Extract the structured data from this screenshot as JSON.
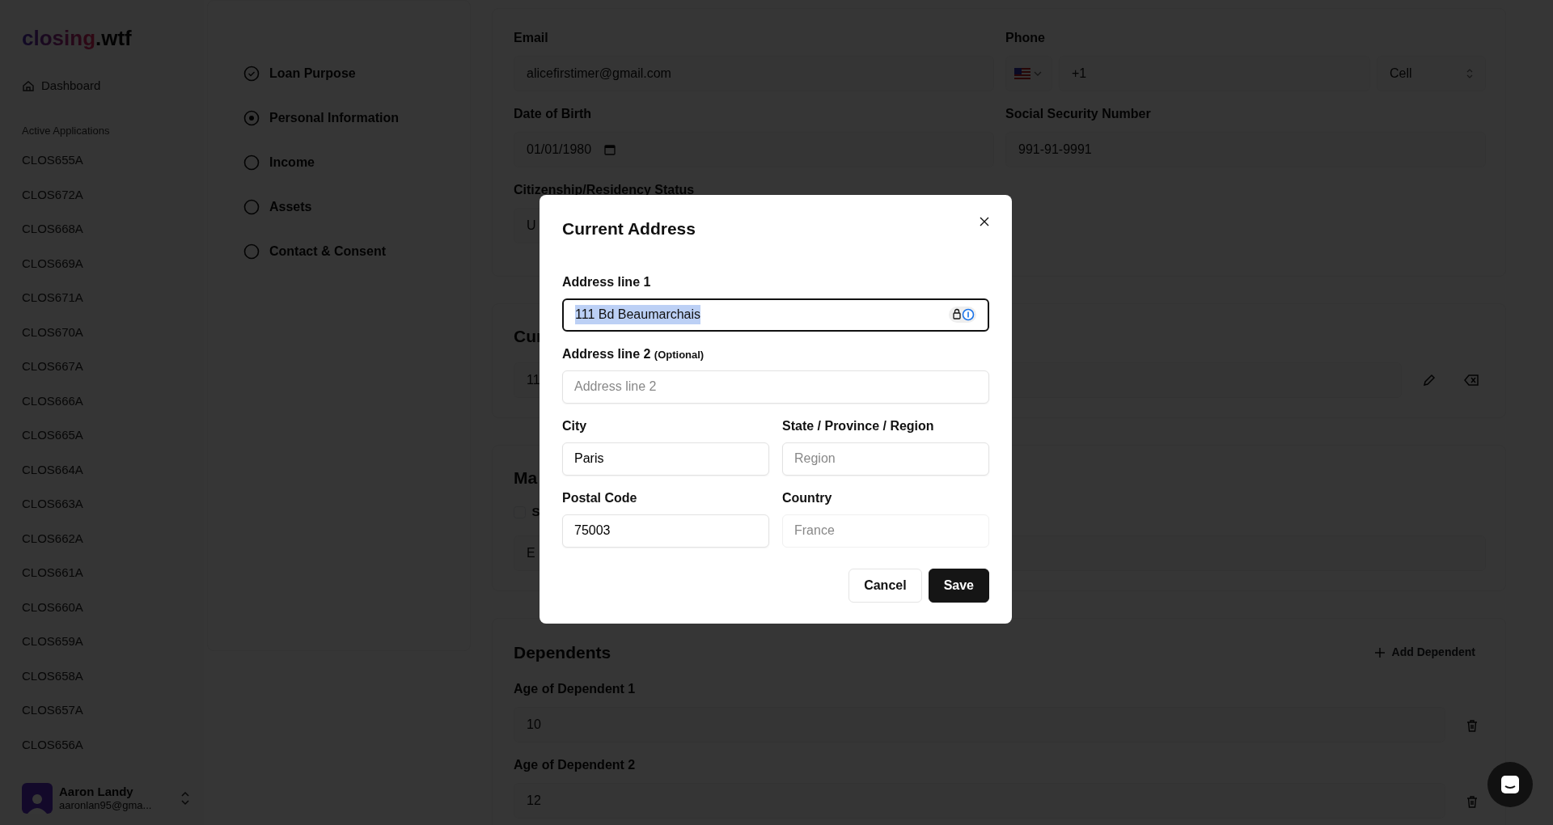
{
  "sidebar": {
    "logo": {
      "name": "closing",
      "suffix": ".wtf"
    },
    "nav": [
      {
        "label": "Dashboard"
      }
    ],
    "section_title": "Active Applications",
    "applications": [
      "CLOS655A",
      "CLOS672A",
      "CLOS668A",
      "CLOS669A",
      "CLOS671A",
      "CLOS670A",
      "CLOS667A",
      "CLOS666A",
      "CLOS665A",
      "CLOS664A",
      "CLOS663A",
      "CLOS662A",
      "CLOS661A",
      "CLOS660A",
      "CLOS659A",
      "CLOS658A",
      "CLOS657A",
      "CLOS656A"
    ],
    "user": {
      "name": "Aaron Landy",
      "email": "aaronlan95@gma..."
    }
  },
  "steps": [
    {
      "label": "Loan Purpose",
      "done": true,
      "current": false
    },
    {
      "label": "Personal Information",
      "done": false,
      "current": true
    },
    {
      "label": "Income",
      "done": false,
      "current": false
    },
    {
      "label": "Assets",
      "done": false,
      "current": false
    },
    {
      "label": "Contact & Consent",
      "done": false,
      "current": false
    }
  ],
  "personal_info": {
    "fields": [
      {
        "label": "Email",
        "kind": "text",
        "value": "alicefirstimer@gmail.com"
      },
      {
        "label": "Phone",
        "kind": "phone",
        "value": "+1",
        "phone_type": "Cell"
      },
      {
        "label": "Date of Birth",
        "kind": "date",
        "value": "01/01/1980"
      },
      {
        "label": "Social Security Number",
        "kind": "text",
        "value": "991-91-9991"
      },
      {
        "label": "Citizenship/Residency Status",
        "kind": "text",
        "value": "U"
      }
    ]
  },
  "current_address": {
    "title": "Cur",
    "value": "11"
  },
  "mailing_address": {
    "title": "Ma",
    "checkbox": {
      "label": "S",
      "checked": false
    },
    "placeholder": "E"
  },
  "dependents": {
    "title": "Dependents",
    "add_button": "Add Dependent",
    "items": [
      {
        "label": "Age of Dependent 1",
        "value": "10"
      },
      {
        "label": "Age of Dependent 2",
        "value": "12"
      }
    ]
  },
  "modal": {
    "title": "Current Address",
    "rows": [
      [
        {
          "label": "Address line 1",
          "value": "111 Bd Beaumarchais",
          "focused": true,
          "text_selected": true,
          "autofill_icon": true
        }
      ],
      [
        {
          "label": "Address line 2",
          "note": "(Optional)",
          "placeholder": "Address line 2"
        }
      ],
      [
        {
          "label": "City",
          "value": "Paris"
        },
        {
          "label": "State / Province / Region",
          "placeholder": "Region"
        }
      ],
      [
        {
          "label": "Postal Code",
          "value": "75003"
        },
        {
          "label": "Country",
          "value": "France",
          "disabled": true
        }
      ]
    ],
    "buttons": [
      {
        "label": "Cancel",
        "kind": "secondary"
      },
      {
        "label": "Save",
        "kind": "primary"
      }
    ]
  }
}
